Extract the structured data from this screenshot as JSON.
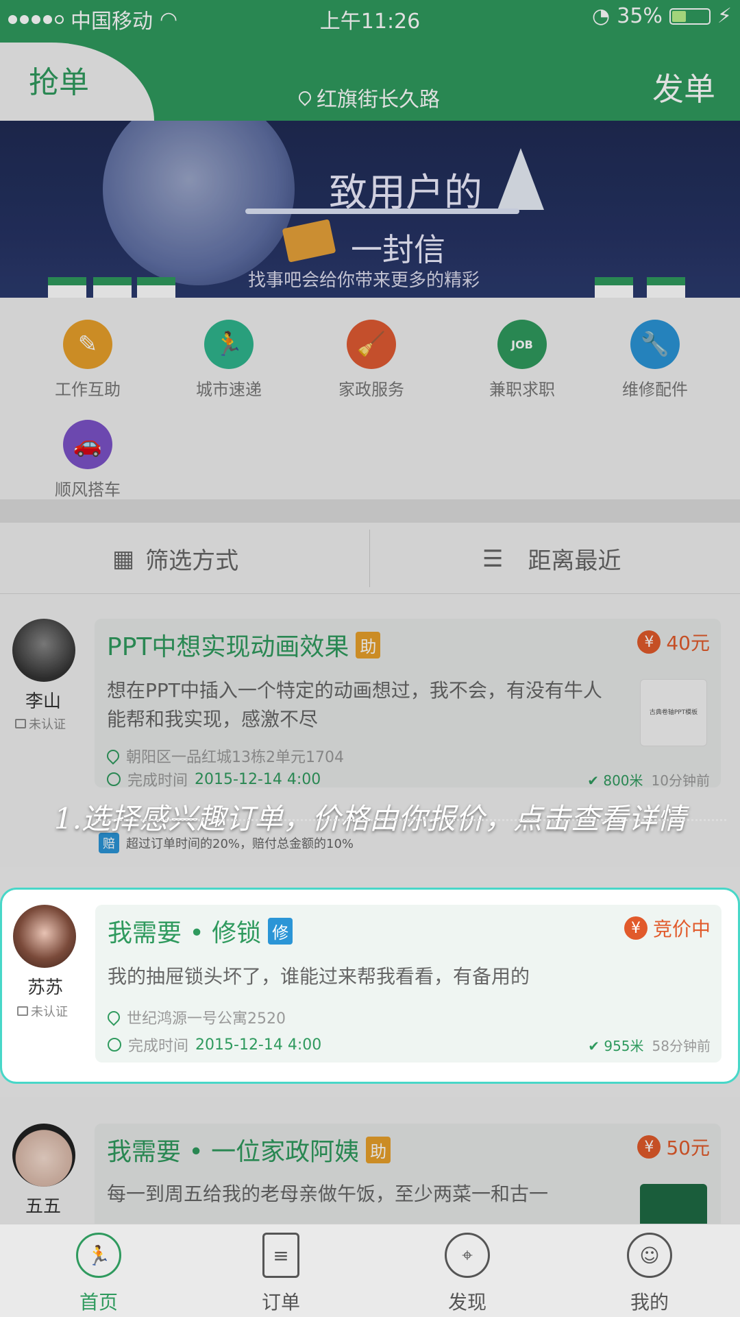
{
  "status_bar": {
    "carrier": "中国移动",
    "time": "上午11:26",
    "battery_percent": "35%",
    "battery_level": 0.35
  },
  "header": {
    "tab_grab": "抢单",
    "location": "红旗街长久路",
    "tab_post": "发单"
  },
  "banner": {
    "title": "致用户的",
    "subtitle": "一封信",
    "note": "找事吧会给你带来更多的精彩"
  },
  "categories": [
    {
      "label": "工作互助",
      "icon": "pen-icon",
      "color": "#e7a02b"
    },
    {
      "label": "城市速递",
      "icon": "runner-icon",
      "color": "#2fb58e"
    },
    {
      "label": "家政服务",
      "icon": "broom-icon",
      "color": "#e05a33"
    },
    {
      "label": "兼职求职",
      "icon": "job-badge-icon",
      "color": "#2f9a5e"
    },
    {
      "label": "维修配件",
      "icon": "wrench-icon",
      "color": "#2b95d6"
    },
    {
      "label": "顺风搭车",
      "icon": "car-icon",
      "color": "#7b52c8"
    }
  ],
  "filter": {
    "left": "筛选方式",
    "right": "距离最近"
  },
  "orders": [
    {
      "user": "李山",
      "cert": "未认证",
      "title": "PPT中想实现动画效果",
      "badge": "助",
      "badge_color": "#e7a02b",
      "price": "40元",
      "desc": "想在PPT中插入一个特定的动画想过，我不会，有没有牛人能帮和我实现，感激不尽",
      "address": "朝阳区一品红城13栋2单元1704",
      "time_label": "完成时间",
      "time_value": "2015-12-14  4:00",
      "distance": "800米",
      "ago": "10分钟前",
      "thumb_text": "古典卷轴PPT模板",
      "compensation_badge": "赔",
      "compensation": "超过订单时间的20%，赔付总金额的10%"
    },
    {
      "user": "苏苏",
      "cert": "未认证",
      "title": "我需要 • 修锁",
      "badge": "修",
      "badge_color": "#2b95d6",
      "price": "竞价中",
      "desc": "我的抽屉锁头坏了，谁能过来帮我看看，有备用的",
      "address": "世纪鸿源一号公寓2520",
      "time_label": "完成时间",
      "time_value": "2015-12-14  4:00",
      "distance": "955米",
      "ago": "58分钟前"
    },
    {
      "user": "五五",
      "title": "我需要 • 一位家政阿姨",
      "badge": "助",
      "badge_color": "#e7a02b",
      "price": "50元",
      "desc": "每一到周五给我的老母亲做午饭，至少两菜一和古一"
    }
  ],
  "hint": "1.选择感兴趣订单，价格由你报价，点击查看详情",
  "nav": [
    {
      "label": "首页",
      "icon": "home-runner-icon"
    },
    {
      "label": "订单",
      "icon": "document-icon"
    },
    {
      "label": "发现",
      "icon": "compass-icon"
    },
    {
      "label": "我的",
      "icon": "person-icon"
    }
  ]
}
